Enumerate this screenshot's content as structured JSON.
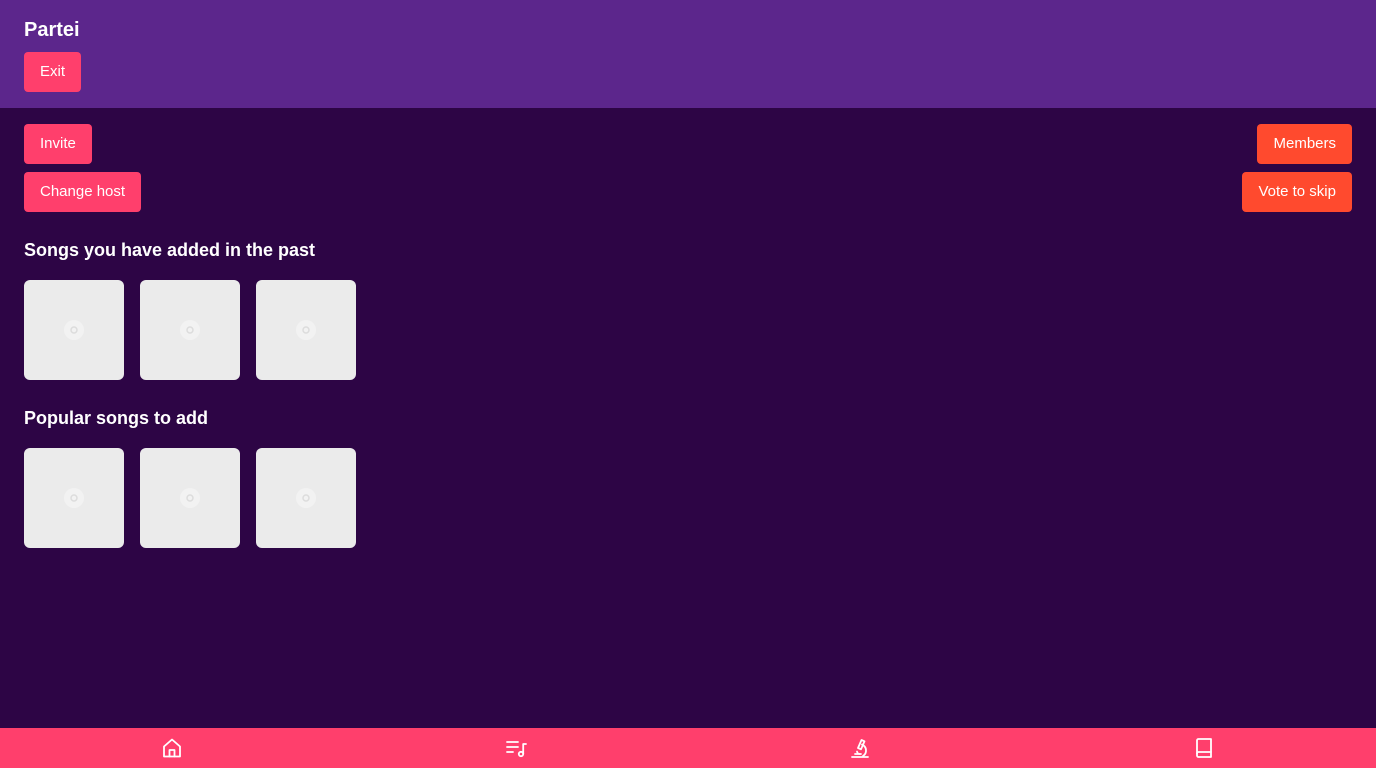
{
  "header": {
    "title": "Partei",
    "exit_label": "Exit"
  },
  "actions": {
    "invite_label": "Invite",
    "change_host_label": "Change host",
    "members_label": "Members",
    "vote_skip_label": "Vote to skip"
  },
  "sections": {
    "past_title": "Songs you have added in the past",
    "popular_title": "Popular songs to add"
  },
  "past_songs": [
    {
      "icon": "disc-placeholder-icon"
    },
    {
      "icon": "disc-placeholder-icon"
    },
    {
      "icon": "disc-placeholder-icon"
    }
  ],
  "popular_songs": [
    {
      "icon": "disc-placeholder-icon"
    },
    {
      "icon": "disc-placeholder-icon"
    },
    {
      "icon": "disc-placeholder-icon"
    }
  ],
  "bottom_nav": [
    {
      "icon": "home-icon"
    },
    {
      "icon": "playlist-icon"
    },
    {
      "icon": "microscope-icon"
    },
    {
      "icon": "book-icon"
    }
  ],
  "colors": {
    "header_bg": "#5c268c",
    "page_bg": "#2d0545",
    "primary_button": "#ff3f6c",
    "secondary_button": "#ff4a2e",
    "card_bg": "#ebebeb"
  }
}
